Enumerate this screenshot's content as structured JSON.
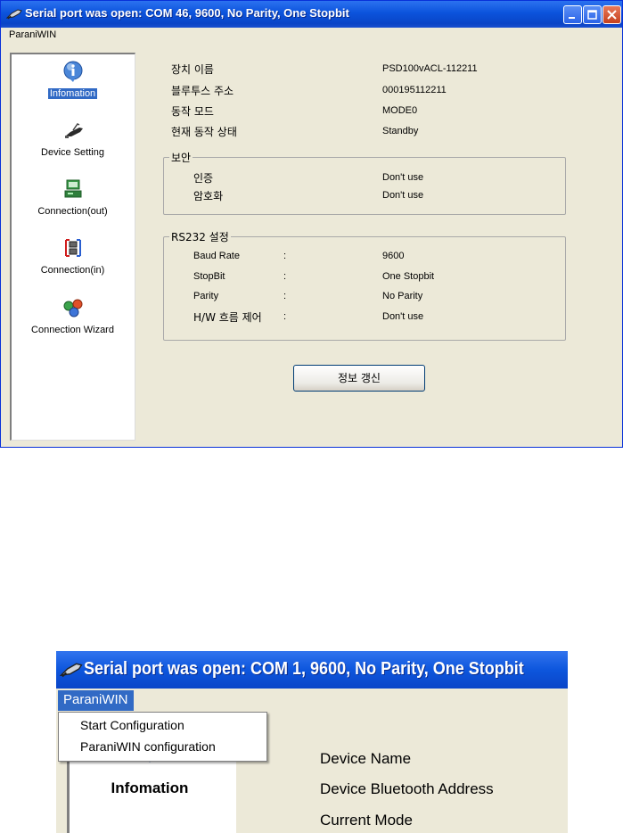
{
  "window1": {
    "title": "Serial port was open: COM 46, 9600, No Parity, One Stopbit",
    "menu": [
      "ParaniWIN"
    ],
    "sidebar": [
      {
        "label": "Infomation",
        "icon": "info-icon",
        "selected": true
      },
      {
        "label": "Device Setting",
        "icon": "device-setting-icon",
        "selected": false
      },
      {
        "label": "Connection(out)",
        "icon": "connection-out-icon",
        "selected": false
      },
      {
        "label": "Connection(in)",
        "icon": "connection-in-icon",
        "selected": false
      },
      {
        "label": "Connection Wizard",
        "icon": "connection-wizard-icon",
        "selected": false
      }
    ],
    "device_info": [
      {
        "label": "장치 이름",
        "value": "PSD100vACL-112211"
      },
      {
        "label": "블루투스 주소",
        "value": "000195112211"
      },
      {
        "label": "동작 모드",
        "value": "MODE0"
      },
      {
        "label": "현재 동작 상태",
        "value": "Standby"
      }
    ],
    "security": {
      "legend": "보안",
      "rows": [
        {
          "label": "인증",
          "value": "Don't use"
        },
        {
          "label": "암호화",
          "value": "Don't use"
        }
      ]
    },
    "rs232": {
      "legend": "RS232 설정",
      "separator": ":",
      "rows": [
        {
          "label": "Baud Rate",
          "value": "9600"
        },
        {
          "label": "StopBit",
          "value": "One Stopbit"
        },
        {
          "label": "Parity",
          "value": "No Parity"
        },
        {
          "label": "H/W 흐름 제어",
          "value": "Don't use"
        }
      ]
    },
    "refresh_button": "정보 갱신"
  },
  "window2": {
    "title": "Serial port was open: COM 1, 9600, No Parity, One Stopbit",
    "menu_label": "ParaniWIN",
    "dropdown": [
      "Start Configuration",
      "ParaniWIN configuration"
    ],
    "sidebar_label": "Infomation",
    "labels": [
      "Device Name",
      "Device Bluetooth Address",
      "Current Mode"
    ]
  },
  "colors": {
    "titlebar_blue": "#0b53dc",
    "window_face": "#ece9d8",
    "selection_blue": "#316ac5"
  }
}
